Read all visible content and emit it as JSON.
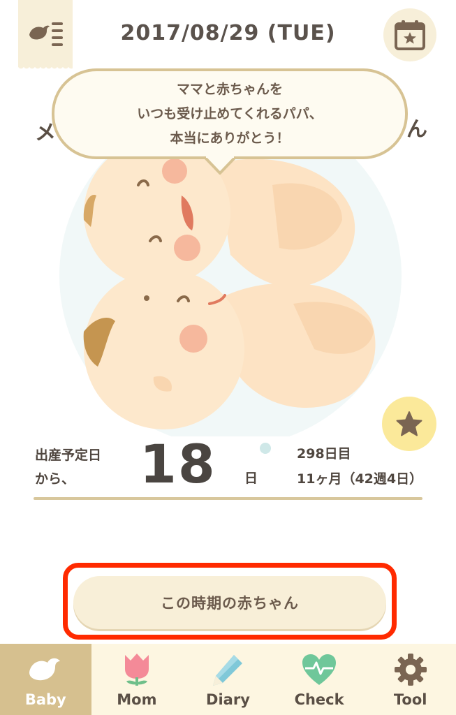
{
  "header": {
    "date": "2017/08/29 (TUE)",
    "menu_icon": "bird-menu-icon",
    "calendar_icon": "calendar-star-icon"
  },
  "bubble": {
    "line1": "ママと赤ちゃんを",
    "line2": "いつも受け止めてくれるパパ、",
    "line3": "本当にありがとう！"
  },
  "peek": {
    "left": "メ",
    "right": "ん"
  },
  "countdown": {
    "label_line1": "出産予定日",
    "label_line2": "から、",
    "number": "18",
    "unit": "日",
    "days": "298日目",
    "months": "11ヶ月（42週4日）"
  },
  "main_button": {
    "label": "この時期の赤ちゃん"
  },
  "nav": {
    "items": [
      {
        "label": "Baby",
        "icon": "bird-icon",
        "active": true
      },
      {
        "label": "Mom",
        "icon": "tulip-icon",
        "active": false
      },
      {
        "label": "Diary",
        "icon": "pencil-icon",
        "active": false
      },
      {
        "label": "Check",
        "icon": "heart-pulse-icon",
        "active": false
      },
      {
        "label": "Tool",
        "icon": "gear-icon",
        "active": false
      }
    ]
  },
  "colors": {
    "accent": "#d6c08f",
    "cream": "#f8efd8",
    "highlight": "#ff2a00",
    "star_yellow": "#fbe99a"
  }
}
